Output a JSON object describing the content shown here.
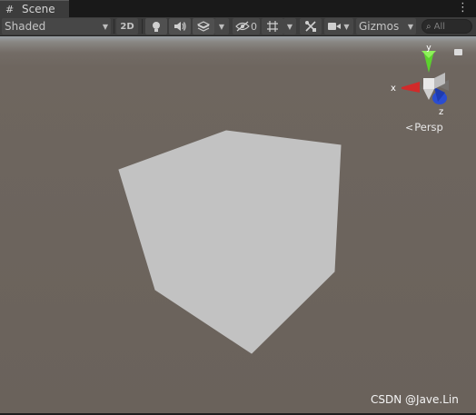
{
  "tab": {
    "label": "Scene",
    "icon": "grid-icon"
  },
  "toolbar": {
    "draw_mode": "Shaded",
    "toggle_2d": "2D",
    "hidden_count": "0",
    "gizmos": "Gizmos",
    "search_placeholder": "All"
  },
  "gizmo": {
    "x": "x",
    "y": "y",
    "z": "z",
    "projection": "Persp"
  },
  "watermark": "CSDN @Jave.Lin",
  "colors": {
    "toolbar": "#3c3c3c",
    "button": "#474747",
    "sky": "#9aa0a6",
    "ground": "#6e665f",
    "cube": "#c2c2c2",
    "axis_x": "#d12a2a",
    "axis_y": "#5cd12e",
    "axis_z": "#2a4dd1"
  }
}
